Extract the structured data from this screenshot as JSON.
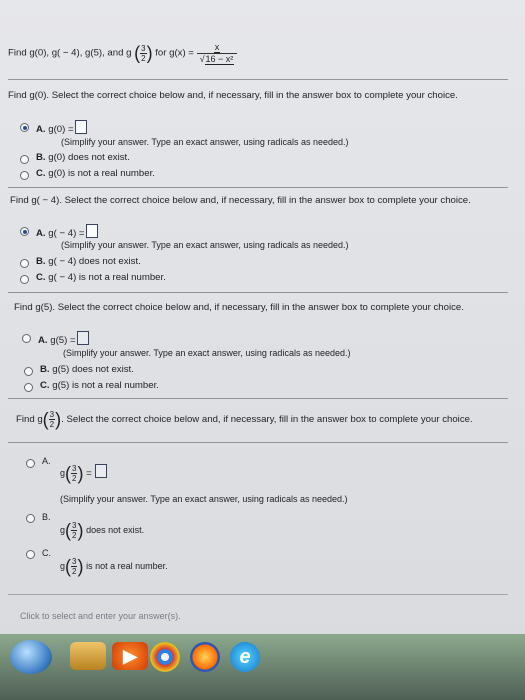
{
  "title": {
    "find_prefix": "Find g(0), g( − 4), g(5), and g",
    "for_text": "for g(x) =",
    "numerator": "x",
    "denominator": "16 − x²",
    "arg_num": "3",
    "arg_den": "2"
  },
  "sections": {
    "s1": {
      "prompt": "Find g(0). Select the correct choice below and, if necessary, fill in the answer box to complete your choice.",
      "A": "g(0) =",
      "A_letter": "A.",
      "A_note": "(Simplify your answer. Type an exact answer, using radicals as needed.)",
      "B_letter": "B.",
      "B": "g(0) does not exist.",
      "C_letter": "C.",
      "C": "g(0) is not a real number."
    },
    "s2": {
      "prompt": "Find g( − 4). Select the correct choice below and, if necessary, fill in the answer box to complete your choice.",
      "A": "g( − 4) =",
      "A_letter": "A.",
      "A_note": "(Simplify your answer. Type an exact answer, using radicals as needed.)",
      "B_letter": "B.",
      "B": "g( − 4) does not exist.",
      "C_letter": "C.",
      "C": "g( − 4) is not a real number."
    },
    "s3": {
      "prompt": "Find g(5). Select the correct choice below and, if necessary, fill in the answer box to complete your choice.",
      "A": "g(5) =",
      "A_letter": "A.",
      "A_note": "(Simplify your answer. Type an exact answer, using radicals as needed.)",
      "B_letter": "B.",
      "B": "g(5) does not exist.",
      "C_letter": "C.",
      "C": "g(5) is not a real number."
    },
    "s4": {
      "prompt_prefix": "Find g",
      "prompt": ". Select the correct choice below and, if necessary, fill in the answer box to complete your choice.",
      "A_letter": "A.",
      "A_note": "(Simplify your answer. Type an exact answer, using radicals as needed.)",
      "B_letter": "B.",
      "B": "does not exist.",
      "C_letter": "C.",
      "C": "is not a real number."
    }
  },
  "footer": "Click to select and enter your answer(s).",
  "taskbar": {
    "start": "Start",
    "icons": [
      "folder-icon",
      "media-player-icon",
      "chrome-icon",
      "firefox-icon",
      "internet-explorer-icon"
    ]
  }
}
